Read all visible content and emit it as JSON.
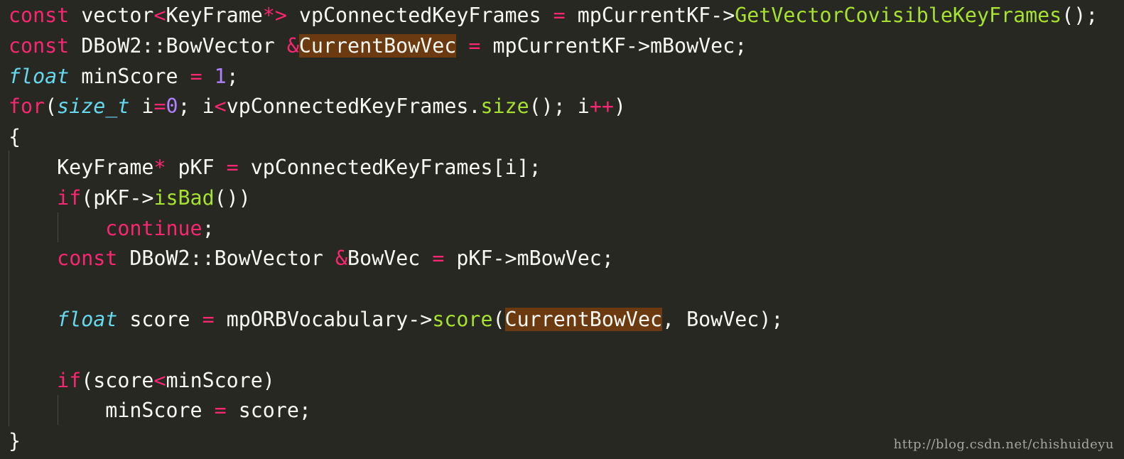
{
  "colors": {
    "background": "#272822",
    "plain": "#f8f8f2",
    "keyword": "#f92672",
    "type_italic": "#66d9ef",
    "function": "#a6e22e",
    "number": "#ae81ff",
    "highlight_bg": "#6b3a10",
    "indent_guide": "#4a4a44",
    "watermark": "#a6a69c"
  },
  "code": {
    "lines": [
      [
        {
          "t": "const",
          "c": "k"
        },
        {
          "t": " vector",
          "c": "p"
        },
        {
          "t": "<",
          "c": "k"
        },
        {
          "t": "KeyFrame",
          "c": "p"
        },
        {
          "t": "*>",
          "c": "k"
        },
        {
          "t": " vpConnectedKeyFrames ",
          "c": "p"
        },
        {
          "t": "=",
          "c": "k"
        },
        {
          "t": " mpCurrentKF->",
          "c": "p"
        },
        {
          "t": "GetVectorCovisibleKeyFrames",
          "c": "f"
        },
        {
          "t": "();",
          "c": "p"
        }
      ],
      [
        {
          "t": "const",
          "c": "k"
        },
        {
          "t": " DBoW2::BowVector ",
          "c": "p"
        },
        {
          "t": "&",
          "c": "k"
        },
        {
          "t": "CurrentBowVec",
          "c": "h"
        },
        {
          "t": " ",
          "c": "p"
        },
        {
          "t": "=",
          "c": "k"
        },
        {
          "t": " mpCurrentKF->mBowVec;",
          "c": "p"
        }
      ],
      [
        {
          "t": "float",
          "c": "t"
        },
        {
          "t": " minScore ",
          "c": "p"
        },
        {
          "t": "=",
          "c": "k"
        },
        {
          "t": " ",
          "c": "p"
        },
        {
          "t": "1",
          "c": "n"
        },
        {
          "t": ";",
          "c": "p"
        }
      ],
      [
        {
          "t": "for",
          "c": "k"
        },
        {
          "t": "(",
          "c": "p"
        },
        {
          "t": "size_t",
          "c": "t"
        },
        {
          "t": " i",
          "c": "p"
        },
        {
          "t": "=",
          "c": "k"
        },
        {
          "t": "0",
          "c": "n"
        },
        {
          "t": "; i",
          "c": "p"
        },
        {
          "t": "<",
          "c": "k"
        },
        {
          "t": "vpConnectedKeyFrames.",
          "c": "p"
        },
        {
          "t": "size",
          "c": "f"
        },
        {
          "t": "(); i",
          "c": "p"
        },
        {
          "t": "++",
          "c": "k"
        },
        {
          "t": ")",
          "c": "p"
        }
      ],
      [
        {
          "t": "{",
          "c": "p"
        }
      ],
      [
        {
          "t": "    KeyFrame",
          "c": "p"
        },
        {
          "t": "*",
          "c": "k"
        },
        {
          "t": " pKF ",
          "c": "p"
        },
        {
          "t": "=",
          "c": "k"
        },
        {
          "t": " vpConnectedKeyFrames[i];",
          "c": "p"
        }
      ],
      [
        {
          "t": "    ",
          "c": "p"
        },
        {
          "t": "if",
          "c": "k"
        },
        {
          "t": "(pKF->",
          "c": "p"
        },
        {
          "t": "isBad",
          "c": "f"
        },
        {
          "t": "())",
          "c": "p"
        }
      ],
      [
        {
          "t": "        ",
          "c": "p"
        },
        {
          "t": "continue",
          "c": "k"
        },
        {
          "t": ";",
          "c": "p"
        }
      ],
      [
        {
          "t": "    ",
          "c": "p"
        },
        {
          "t": "const",
          "c": "k"
        },
        {
          "t": " DBoW2::BowVector ",
          "c": "p"
        },
        {
          "t": "&",
          "c": "k"
        },
        {
          "t": "BowVec ",
          "c": "p"
        },
        {
          "t": "=",
          "c": "k"
        },
        {
          "t": " pKF->mBowVec;",
          "c": "p"
        }
      ],
      [],
      [
        {
          "t": "    ",
          "c": "p"
        },
        {
          "t": "float",
          "c": "t"
        },
        {
          "t": " score ",
          "c": "p"
        },
        {
          "t": "=",
          "c": "k"
        },
        {
          "t": " mpORBVocabulary->",
          "c": "p"
        },
        {
          "t": "score",
          "c": "f"
        },
        {
          "t": "(",
          "c": "p"
        },
        {
          "t": "CurrentBowVec",
          "c": "h"
        },
        {
          "t": ", BowVec);",
          "c": "p"
        }
      ],
      [],
      [
        {
          "t": "    ",
          "c": "p"
        },
        {
          "t": "if",
          "c": "k"
        },
        {
          "t": "(score",
          "c": "p"
        },
        {
          "t": "<",
          "c": "k"
        },
        {
          "t": "minScore)",
          "c": "p"
        }
      ],
      [
        {
          "t": "        minScore ",
          "c": "p"
        },
        {
          "t": "=",
          "c": "k"
        },
        {
          "t": " score;",
          "c": "p"
        }
      ],
      [
        {
          "t": "}",
          "c": "p"
        }
      ]
    ]
  },
  "watermark": {
    "text": "http://blog.csdn.net/chishuideyu"
  }
}
